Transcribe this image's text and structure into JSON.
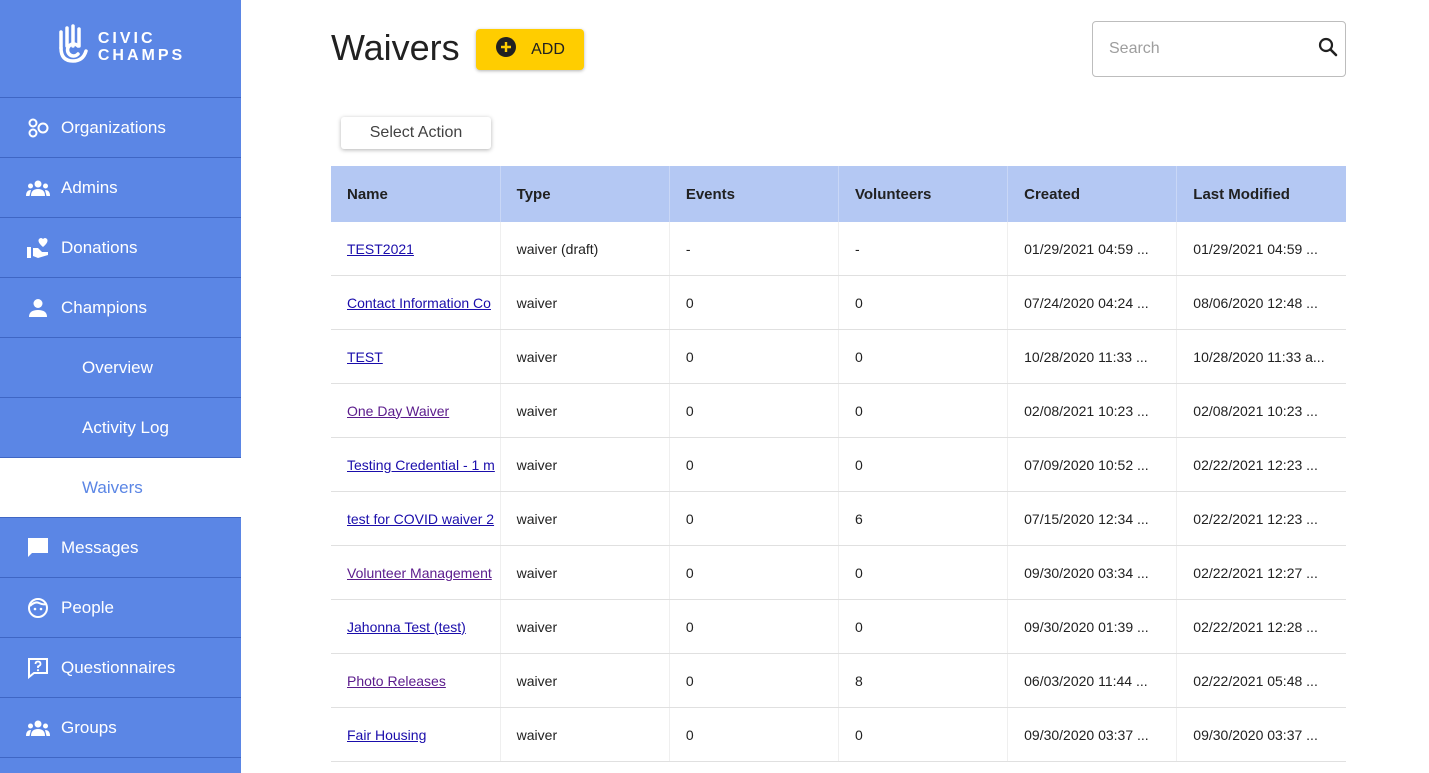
{
  "brand": {
    "line1": "CIVIC",
    "line2": "CHAMPS"
  },
  "sidebar": {
    "items": [
      {
        "label": "Organizations",
        "icon": "organizations-icon"
      },
      {
        "label": "Admins",
        "icon": "admins-icon"
      },
      {
        "label": "Donations",
        "icon": "donations-icon"
      },
      {
        "label": "Champions",
        "icon": "person-icon"
      },
      {
        "label": "Overview"
      },
      {
        "label": "Activity Log"
      },
      {
        "label": "Waivers",
        "active": true
      },
      {
        "label": "Messages",
        "icon": "chat-icon"
      },
      {
        "label": "People",
        "icon": "face-icon"
      },
      {
        "label": "Questionnaires",
        "icon": "question-icon"
      },
      {
        "label": "Groups",
        "icon": "groups-icon"
      }
    ]
  },
  "header": {
    "title": "Waivers",
    "add_label": "ADD",
    "search_placeholder": "Search"
  },
  "toolbar": {
    "select_action_label": "Select Action"
  },
  "table": {
    "columns": [
      "Name",
      "Type",
      "Events",
      "Volunteers",
      "Created",
      "Last Modified"
    ],
    "rows": [
      {
        "name": "TEST2021",
        "type": "waiver (draft)",
        "events": "-",
        "volunteers": "-",
        "created": "01/29/2021 04:59 ...",
        "modified": "01/29/2021 04:59 ..."
      },
      {
        "name": "Contact Information Co",
        "type": "waiver",
        "events": "0",
        "volunteers": "0",
        "created": "07/24/2020 04:24 ...",
        "modified": "08/06/2020 12:48 ..."
      },
      {
        "name": "TEST",
        "type": "waiver",
        "events": "0",
        "volunteers": "0",
        "created": "10/28/2020 11:33 ...",
        "modified": "10/28/2020 11:33 a..."
      },
      {
        "name": "One Day Waiver",
        "type": "waiver",
        "events": "0",
        "volunteers": "0",
        "created": "02/08/2021 10:23 ...",
        "modified": "02/08/2021 10:23 ..."
      },
      {
        "name": "Testing Credential - 1 m",
        "type": "waiver",
        "events": "0",
        "volunteers": "0",
        "created": "07/09/2020 10:52 ...",
        "modified": "02/22/2021 12:23 ..."
      },
      {
        "name": "test for COVID waiver 2",
        "type": "waiver",
        "events": "0",
        "volunteers": "6",
        "created": "07/15/2020 12:34 ...",
        "modified": "02/22/2021 12:23 ..."
      },
      {
        "name": "Volunteer Management",
        "type": "waiver",
        "events": "0",
        "volunteers": "0",
        "created": "09/30/2020 03:34 ...",
        "modified": "02/22/2021 12:27 ..."
      },
      {
        "name": "Jahonna Test (test)",
        "type": "waiver",
        "events": "0",
        "volunteers": "0",
        "created": "09/30/2020 01:39 ...",
        "modified": "02/22/2021 12:28 ..."
      },
      {
        "name": "Photo Releases",
        "type": "waiver",
        "events": "0",
        "volunteers": "8",
        "created": "06/03/2020 11:44 ...",
        "modified": "02/22/2021 05:48 ..."
      },
      {
        "name": "Fair Housing",
        "type": "waiver",
        "events": "0",
        "volunteers": "0",
        "created": "09/30/2020 03:37 ...",
        "modified": "09/30/2020 03:37 ..."
      }
    ]
  },
  "colors": {
    "sidebar": "#5b86e5",
    "accent_button": "#ffcd00",
    "table_header": "#b4c8f3",
    "link": "#1a0dab",
    "link_visited": "#5b1b8c"
  }
}
